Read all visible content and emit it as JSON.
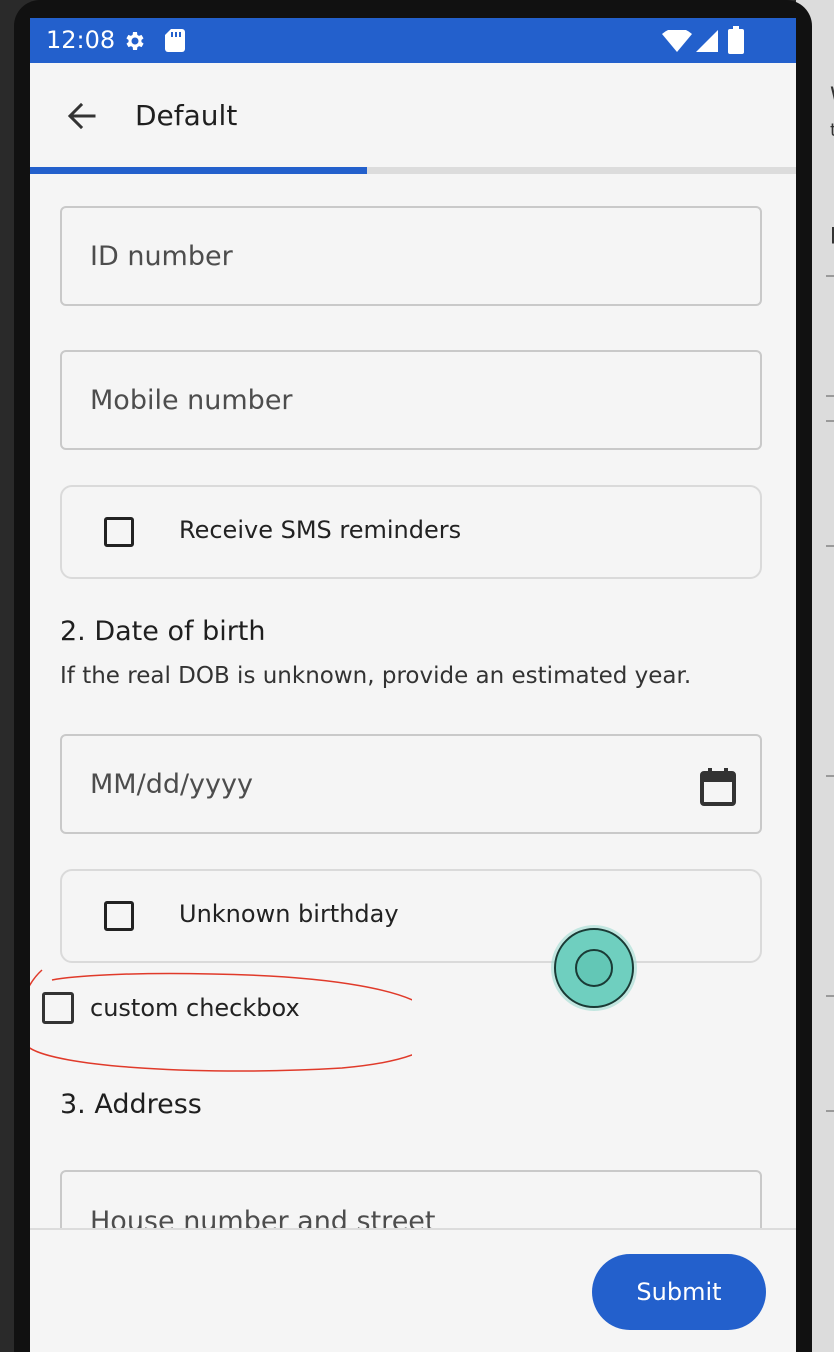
{
  "status_bar": {
    "time": "12:08",
    "icons": [
      "gear-icon",
      "sd-card-icon",
      "wifi-icon",
      "signal-icon",
      "battery-icon"
    ]
  },
  "app_bar": {
    "title": "Default",
    "back_icon": "arrow-back-icon"
  },
  "progress": {
    "fraction": 0.44,
    "color": "#2360cc"
  },
  "form": {
    "id_number": {
      "placeholder": "ID number"
    },
    "mobile_number": {
      "placeholder": "Mobile number"
    },
    "sms_reminders": {
      "label": "Receive SMS reminders",
      "checked": false
    },
    "dob_section": {
      "title": "2. Date of birth",
      "help": "If the real DOB is unknown, provide an estimated year."
    },
    "dob_field": {
      "placeholder": "MM/dd/yyyy",
      "icon": "calendar-icon"
    },
    "unknown_birthday": {
      "label": "Unknown birthday",
      "checked": false
    },
    "custom_checkbox": {
      "label": "custom checkbox",
      "checked": false
    },
    "address_section": {
      "title": "3. Address"
    },
    "house_street": {
      "placeholder": "House number and street"
    }
  },
  "footer": {
    "submit_label": "Submit"
  },
  "colors": {
    "primary": "#2360cc",
    "annotation": "#e03a2a",
    "touch_indicator": "#6fcfbf"
  },
  "background": {
    "fragments": [
      "W",
      "t",
      "p"
    ]
  }
}
